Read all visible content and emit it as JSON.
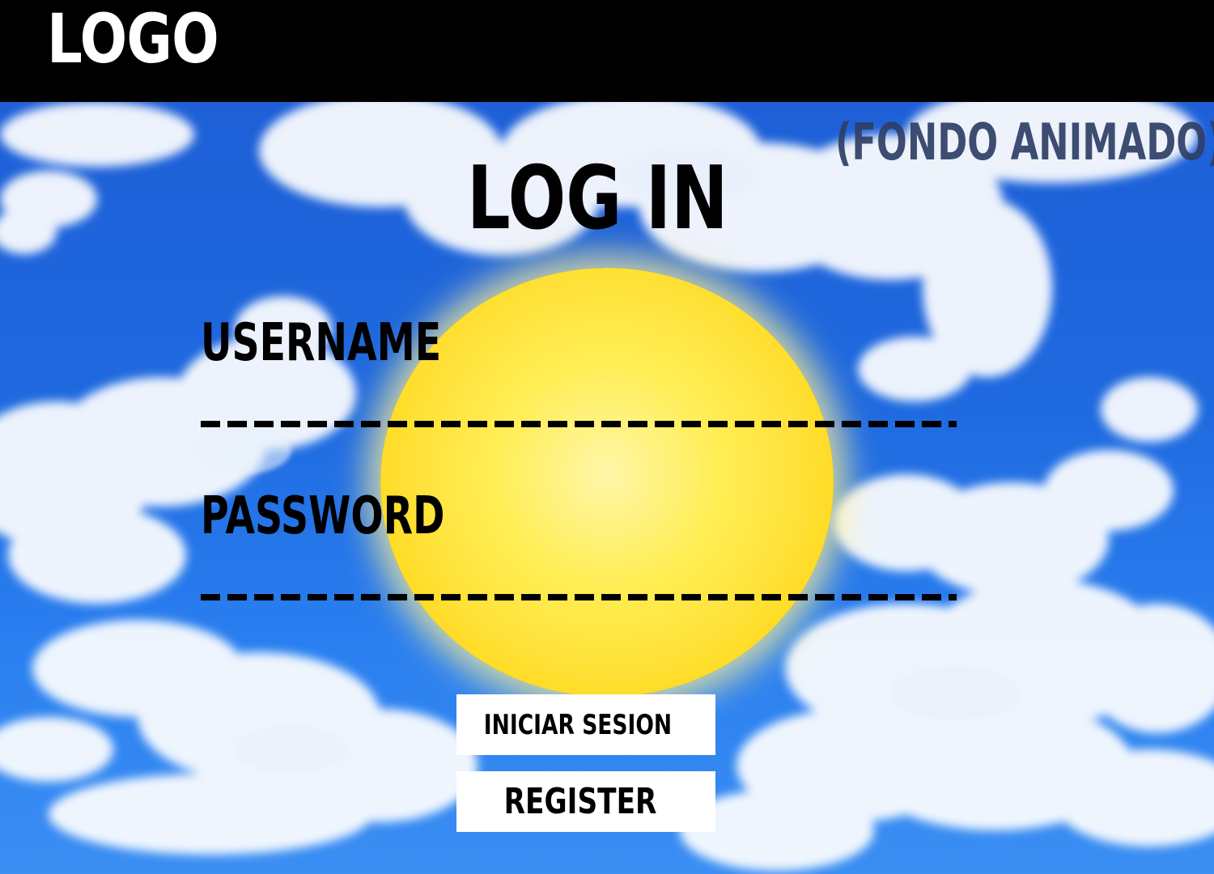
{
  "header": {
    "logo_text": "LOGO"
  },
  "background": {
    "note_label": "(FONDO ANIMADO)",
    "sky_color": "#1f6ae0",
    "sun_color": "#ffe23a"
  },
  "form": {
    "title": "LOG IN",
    "username_label": "USERNAME",
    "username_value": "",
    "password_label": "PASSWORD",
    "password_value": ""
  },
  "buttons": {
    "login_label": "INICIAR SESION",
    "register_label": "REGISTER"
  }
}
